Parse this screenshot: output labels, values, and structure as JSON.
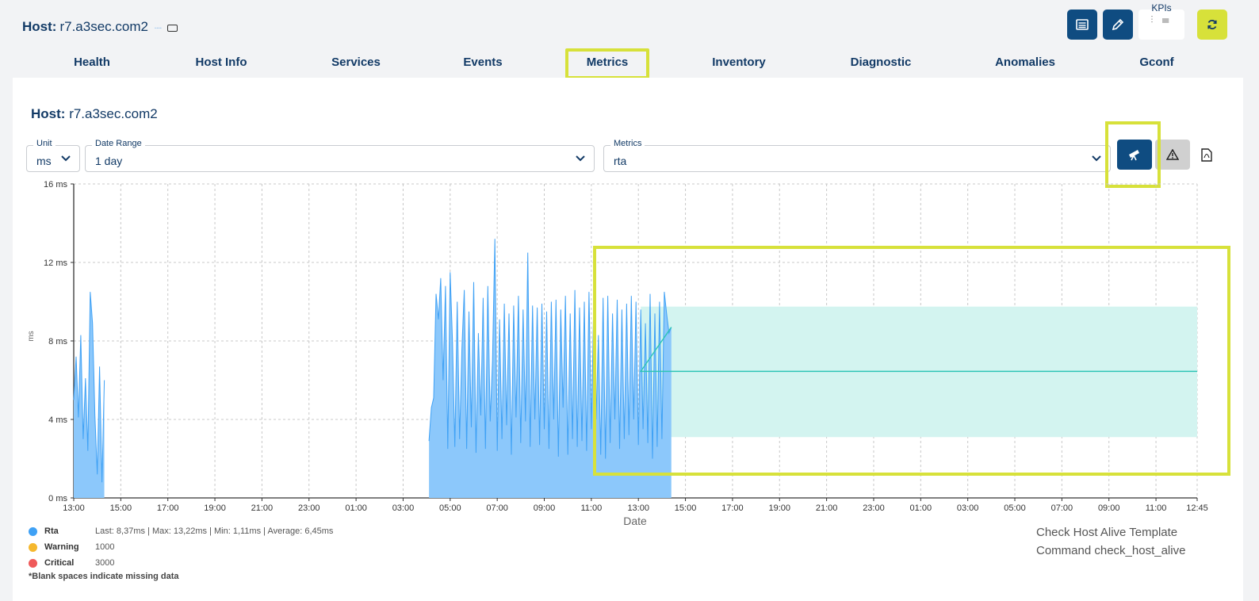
{
  "header": {
    "host_label": "Host:",
    "host_name": "r7.a3sec.com2",
    "kpis_label": "KPIs"
  },
  "tabs": [
    {
      "label": "Health"
    },
    {
      "label": "Host Info"
    },
    {
      "label": "Services"
    },
    {
      "label": "Events"
    },
    {
      "label": "Metrics",
      "active": true
    },
    {
      "label": "Inventory"
    },
    {
      "label": "Diagnostic"
    },
    {
      "label": "Anomalies"
    },
    {
      "label": "Gconf"
    }
  ],
  "panel": {
    "host_label": "Host:",
    "host_name": "r7.a3sec.com2"
  },
  "filters": {
    "unit": {
      "legend": "Unit",
      "value": "ms"
    },
    "date_range": {
      "legend": "Date Range",
      "value": "1 day"
    },
    "metrics": {
      "legend": "Metrics",
      "value": "rta"
    }
  },
  "icons": {
    "table": "table-icon",
    "edit": "pencil-icon",
    "kpis": "kpi-icon",
    "refresh": "refresh-icon",
    "forecast": "telescope-icon",
    "alert": "warning-icon",
    "pdf": "pdf-icon"
  },
  "colors": {
    "primary": "#0f4c81",
    "accent": "#d7e13a",
    "rta": "#3fa1f5",
    "warning": "#f5b82e",
    "critical": "#ef5a5a",
    "forecast": "#2ec4b6",
    "forecast_band": "#d3f4f0"
  },
  "chart_data": {
    "type": "area",
    "xlabel": "Date",
    "ylabel": "ms",
    "ylim": [
      0,
      16
    ],
    "yticks": [
      "0 ms",
      "4 ms",
      "8 ms",
      "12 ms",
      "16 ms"
    ],
    "xticks": [
      "13:00",
      "15:00",
      "17:00",
      "19:00",
      "21:00",
      "23:00",
      "01:00",
      "03:00",
      "05:00",
      "07:00",
      "09:00",
      "11:00",
      "13:00",
      "15:00",
      "17:00",
      "19:00",
      "21:00",
      "23:00",
      "01:00",
      "03:00",
      "05:00",
      "07:00",
      "09:00",
      "11:00",
      "12:45"
    ],
    "grid": true,
    "series": [
      {
        "name": "Rta",
        "segments": [
          {
            "start_hour": 0.0,
            "step_hours": 0.1,
            "values": [
              5.0,
              7.2,
              4.1,
              8.3,
              3.0,
              6.1,
              2.4,
              10.5,
              8.9,
              4.2,
              1.2,
              6.7,
              0.8,
              6.0
            ]
          },
          {
            "start_hour": 15.1,
            "step_hours": 0.1,
            "values": [
              2.9,
              4.6,
              5.1,
              10.4,
              9.1,
              11.2,
              6.0,
              10.8,
              2.5,
              11.5,
              7.9,
              2.6,
              10.0,
              3.0,
              7.6,
              10.6,
              2.5,
              9.5,
              3.6,
              11.0,
              2.3,
              8.4,
              4.2,
              10.2,
              2.5,
              10.8,
              3.9,
              7.0,
              13.2,
              2.4,
              9.1,
              3.0,
              9.9,
              3.7,
              9.4,
              2.2,
              9.8,
              4.1,
              10.3,
              2.8,
              9.6,
              3.9,
              12.5,
              2.6,
              9.8,
              4.0,
              9.7,
              2.7,
              9.9,
              3.5,
              9.5,
              2.5,
              10.0,
              4.0,
              10.1,
              2.1,
              9.6,
              4.6,
              10.3,
              2.2,
              9.4,
              3.0,
              10.6,
              2.6,
              9.7,
              2.9,
              10.0,
              2.4,
              10.5,
              3.5,
              9.8,
              4.0,
              8.3,
              2.2,
              10.2,
              2.0,
              10.3,
              2.8,
              9.4,
              4.0,
              10.1,
              2.5,
              9.6,
              3.0,
              9.9,
              3.2,
              10.3,
              4.0,
              10.0,
              2.7,
              9.6,
              3.5,
              8.9,
              2.8,
              10.4,
              2.0,
              9.4,
              2.6,
              10.0,
              3.0,
              10.5,
              9.4,
              8.4,
              8.7
            ]
          }
        ],
        "last": "8,37ms",
        "max": "13,22ms",
        "min": "1,11ms",
        "average": "6,45ms"
      },
      {
        "name": "Forecast",
        "x_start_hour": 24.1,
        "x_end_hour": 47.75,
        "values": [
          6.45,
          6.45
        ],
        "band_lower": 3.1,
        "band_upper": 9.75
      }
    ]
  },
  "legend": {
    "items": [
      {
        "label": "Rta",
        "text": "Last: 8,37ms | Max: 13,22ms | Min: 1,11ms | Average: 6,45ms"
      },
      {
        "label": "Warning",
        "text": "1000"
      },
      {
        "label": "Critical",
        "text": "3000"
      }
    ],
    "note": "*Blank spaces indicate missing data"
  },
  "command": {
    "line1": "Check Host Alive Template",
    "line2": "Command check_host_alive"
  }
}
